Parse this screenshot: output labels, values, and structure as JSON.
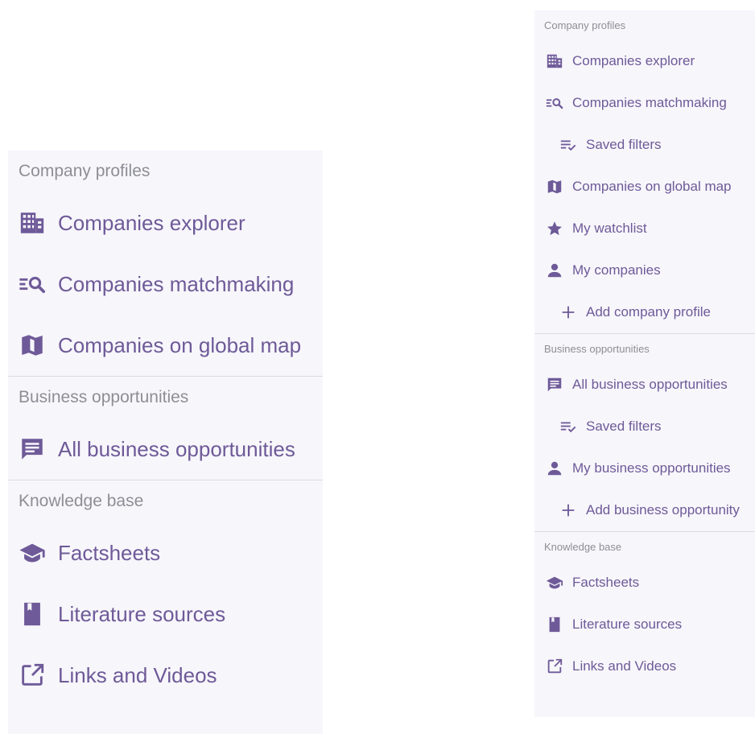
{
  "colors": {
    "accent": "#6e5a98",
    "heading": "#8e8e96",
    "panel_bg": "#f7f6fb",
    "divider": "#dcdbe3"
  },
  "large_menu": {
    "company_profiles": {
      "heading": "Company profiles",
      "items": [
        {
          "label": "Companies explorer",
          "icon": "building-icon"
        },
        {
          "label": "Companies matchmaking",
          "icon": "list-search-icon"
        },
        {
          "label": "Companies on global map",
          "icon": "map-icon"
        }
      ]
    },
    "business_opportunities": {
      "heading": "Business opportunities",
      "items": [
        {
          "label": "All business opportunities",
          "icon": "message-icon"
        }
      ]
    },
    "knowledge_base": {
      "heading": "Knowledge base",
      "items": [
        {
          "label": "Factsheets",
          "icon": "graduation-cap-icon"
        },
        {
          "label": "Literature sources",
          "icon": "book-icon"
        },
        {
          "label": "Links and Videos",
          "icon": "external-link-icon"
        }
      ]
    }
  },
  "small_menu": {
    "company_profiles": {
      "heading": "Company profiles",
      "items": [
        {
          "label": "Companies explorer",
          "icon": "building-icon"
        },
        {
          "label": "Companies matchmaking",
          "icon": "list-search-icon"
        },
        {
          "label": "Saved filters",
          "icon": "list-check-icon"
        },
        {
          "label": "Companies on global map",
          "icon": "map-icon"
        },
        {
          "label": "My watchlist",
          "icon": "star-icon"
        },
        {
          "label": "My companies",
          "icon": "person-icon"
        },
        {
          "label": "Add company profile",
          "icon": "plus-icon"
        }
      ]
    },
    "business_opportunities": {
      "heading": "Business opportunities",
      "items": [
        {
          "label": "All business opportunities",
          "icon": "message-icon"
        },
        {
          "label": "Saved filters",
          "icon": "list-check-icon"
        },
        {
          "label": "My business opportunities",
          "icon": "person-icon"
        },
        {
          "label": "Add business opportunity",
          "icon": "plus-icon"
        }
      ]
    },
    "knowledge_base": {
      "heading": "Knowledge base",
      "items": [
        {
          "label": "Factsheets",
          "icon": "graduation-cap-icon"
        },
        {
          "label": "Literature sources",
          "icon": "book-icon"
        },
        {
          "label": "Links and Videos",
          "icon": "external-link-icon"
        }
      ]
    }
  }
}
